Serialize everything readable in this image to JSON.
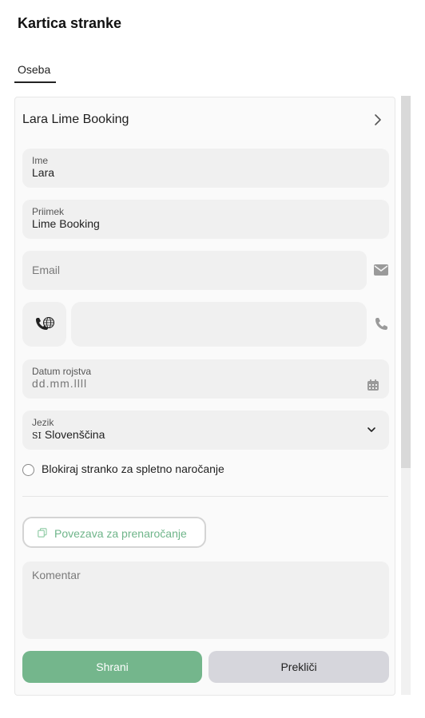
{
  "page_title": "Kartica stranke",
  "tabs": [
    {
      "label": "Oseba"
    }
  ],
  "card": {
    "title": "Lara Lime Booking",
    "first_name": {
      "label": "Ime",
      "value": "Lara"
    },
    "last_name": {
      "label": "Priimek",
      "value": "Lime Booking"
    },
    "email": {
      "placeholder": "Email"
    },
    "phone": {
      "value": ""
    },
    "birthdate": {
      "label": "Datum rojstva",
      "placeholder": "dd.mm.llll"
    },
    "language": {
      "label": "Jezik",
      "flag": "SI",
      "value": "Slovenščina"
    },
    "block_online": {
      "label": "Blokiraj stranko za spletno naročanje",
      "checked": false
    },
    "rebook_link": {
      "label": "Povezava za prenaročanje"
    },
    "comment": {
      "placeholder": "Komentar"
    },
    "save_label": "Shrani",
    "cancel_label": "Prekliči"
  },
  "colors": {
    "accent": "#74b68c",
    "cancel_bg": "#d6d6dc",
    "field_bg": "#f0f0f0"
  }
}
